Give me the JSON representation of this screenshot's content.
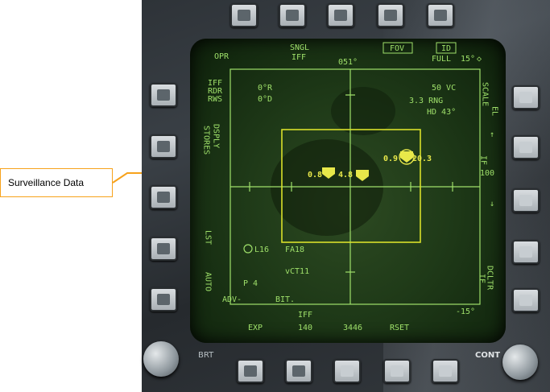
{
  "callout": {
    "label": "Surveillance Data",
    "color": "#f7a21b"
  },
  "ddi": {
    "top": {
      "opr": "OPR",
      "sngl": "SNGL",
      "iff": "IFF",
      "heading": "051°",
      "fov": "FOV",
      "id": "ID",
      "full": "FULL",
      "elevation": "15°"
    },
    "left_labels": [
      "IFF",
      "RDR",
      "RWS"
    ],
    "stores_label": "STORES",
    "dsply_label": "DSPLY",
    "lst_label": "LST",
    "auto_label": "AUTO",
    "right": {
      "scale_label": "SCALE",
      "range": "100",
      "declutter_label": "DCLTR",
      "dclttr_extra": "IF"
    },
    "bearing_r": "0°R",
    "bearing_d": "0°D",
    "vc": "50 VC",
    "rng": "3.3 RNG",
    "hd": "HD 43°",
    "contacts": [
      {
        "id": "c1",
        "label": "0.8"
      },
      {
        "id": "c2",
        "label": "4.8"
      },
      {
        "id": "c3",
        "label": "0.9"
      },
      {
        "id": "c4",
        "label": "20.3"
      }
    ],
    "surveillance": {
      "l16": "L16",
      "fa18": "FA18",
      "vct": "vCT11",
      "p4": "P 4"
    },
    "bottom_status": {
      "adv": "ADV-",
      "bit": "BIT.",
      "elev": "-15°"
    },
    "bottom": {
      "exp": "EXP",
      "iff_label": "IFF",
      "iff_val": "140",
      "code": "3446",
      "rset": "RSET"
    },
    "brt_label": "BRT",
    "cont_label": "CONT",
    "accent": "#9fe06a"
  }
}
